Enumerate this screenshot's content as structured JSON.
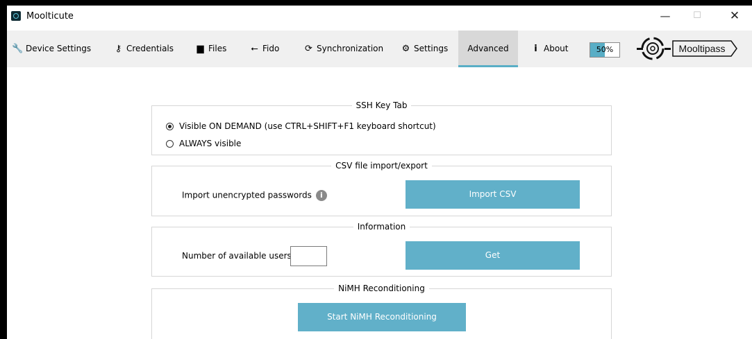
{
  "window": {
    "title": "Moolticute",
    "min": "—",
    "max": "☐",
    "close": "✕"
  },
  "tabs": [
    {
      "label": "Device Settings",
      "icon": "wrench-icon",
      "glyph": "🔧"
    },
    {
      "label": "Credentials",
      "icon": "key-icon",
      "glyph": "⚷"
    },
    {
      "label": "Files",
      "icon": "file-icon",
      "glyph": "▆"
    },
    {
      "label": "Fido",
      "icon": "usb-icon",
      "glyph": "⭠"
    },
    {
      "label": "Synchronization",
      "icon": "sync-icon",
      "glyph": "⟳"
    },
    {
      "label": "Settings",
      "icon": "gears-icon",
      "glyph": "⚙"
    },
    {
      "label": "Advanced",
      "icon": "",
      "glyph": ""
    },
    {
      "label": "About",
      "icon": "info-icon",
      "glyph": "ℹ"
    }
  ],
  "active_tab": "Advanced",
  "progress": {
    "value": 0.5,
    "label": "50%"
  },
  "logo_text": "Mooltipass",
  "ssh": {
    "title": "SSH Key Tab",
    "option1": "Visible ON DEMAND  (use CTRL+SHIFT+F1 keyboard shortcut)",
    "option2": "ALWAYS visible",
    "selected": "option1"
  },
  "csv": {
    "title": "CSV file import/export",
    "label": "Import unencrypted passwords",
    "button": "Import CSV"
  },
  "information": {
    "title": "Information",
    "label": "Number of available users:",
    "value": "",
    "button": "Get"
  },
  "nimh": {
    "title": "NiMH Reconditioning",
    "button": "Start NiMH Reconditioning"
  },
  "colors": {
    "accent": "#59aec6",
    "button": "#61b0c9",
    "tabbar": "#f0f0f0"
  }
}
